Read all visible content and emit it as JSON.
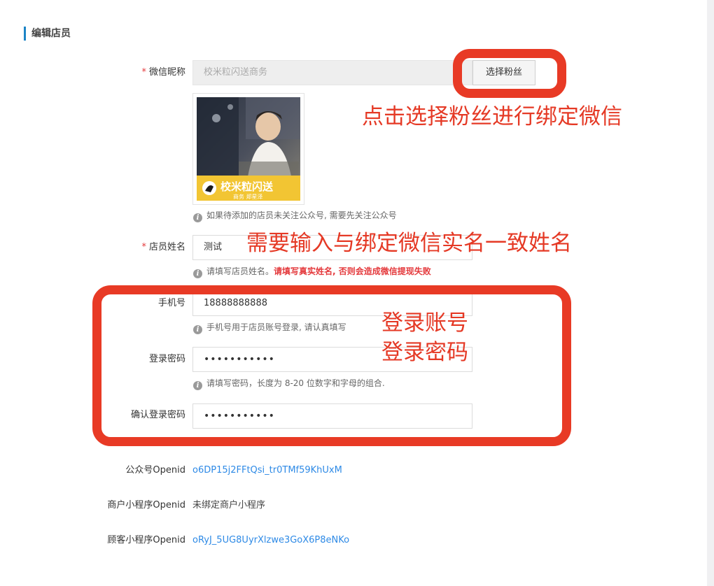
{
  "section": {
    "title": "编辑店员"
  },
  "wechat_nickname": {
    "label": "微信昵称",
    "value": "校米粒闪送商务",
    "select_button": "选择粉丝",
    "avatar_brand": "校米粒闪送",
    "avatar_sub": "商务 郑星泽",
    "help": "如果待添加的店员未关注公众号, 需要先关注公众号"
  },
  "staff_name": {
    "label": "店员姓名",
    "value": "测试",
    "help_normal": "请填写店员姓名。",
    "help_warning": "请填写真实姓名, 否则会造成微信提现失败"
  },
  "phone": {
    "label": "手机号",
    "value": "18888888888",
    "help": "手机号用于店员账号登录, 请认真填写"
  },
  "password": {
    "label": "登录密码",
    "value": "•••••••••••",
    "help": "请填写密码，长度为 8-20 位数字和字母的组合."
  },
  "confirm_password": {
    "label": "确认登录密码",
    "value": "•••••••••••"
  },
  "openids": {
    "public_label": "公众号Openid",
    "public_value": "o6DP15j2FFtQsi_tr0TMf59KhUxM",
    "merchant_label": "商户小程序Openid",
    "merchant_value": "未绑定商户小程序",
    "customer_label": "顾客小程序Openid",
    "customer_value": "oRyJ_5UG8UyrXlzwe3GoX6P8eNKo"
  },
  "annotations": {
    "select_fans": "点击选择粉丝进行绑定微信",
    "real_name": "需要输入与绑定微信实名一致姓名",
    "login_account": "登录账号",
    "login_password": "登录密码"
  },
  "colors": {
    "accent": "#1c84c6",
    "link": "#2e8ae6",
    "warning": "#e4393c",
    "annotation": "#e83a25"
  }
}
